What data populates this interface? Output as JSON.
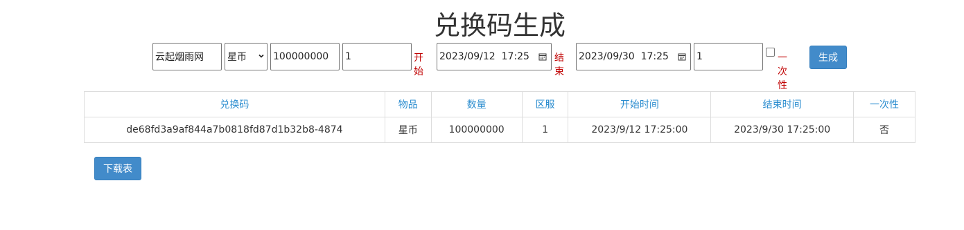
{
  "page": {
    "title": "兑换码生成"
  },
  "form": {
    "server_name_value": "云起烟雨网",
    "item_select": {
      "selected": "星币"
    },
    "quantity_value": "100000000",
    "zone_value": "1",
    "start_label": "开始",
    "start_datetime_value": "2023/09/12  17:25",
    "end_label": "结束",
    "end_datetime_value": "2023/09/30  17:25",
    "count_value": "1",
    "one_time_label": "一次性",
    "one_time_checked": false,
    "generate_label": "生成"
  },
  "table": {
    "headers": [
      "兑换码",
      "物品",
      "数量",
      "区服",
      "开始时间",
      "结束时间",
      "一次性"
    ],
    "rows": [
      [
        "de68fd3a9af844a7b0818fd87d1b32b8-4874",
        "星币",
        "100000000",
        "1",
        "2023/9/12 17:25:00",
        "2023/9/30 17:25:00",
        "否"
      ]
    ]
  },
  "download_label": "下载表",
  "colors": {
    "accent": "#428bca",
    "header_text": "#2a8ccf",
    "label_red": "#c00000",
    "border": "#dddddd"
  },
  "icons": {
    "date_picker": "calendar-icon",
    "select": "chevron-down-icon"
  }
}
